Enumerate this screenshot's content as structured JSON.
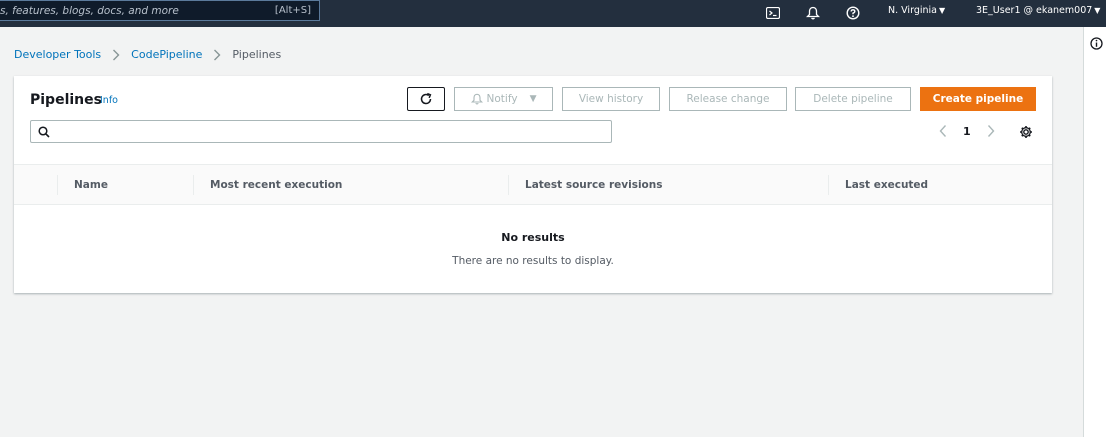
{
  "topbar": {
    "search_placeholder": "s, features, blogs, docs, and more",
    "search_shortcut": "[Alt+S]",
    "region": "N. Virginia",
    "account": "3E_User1 @ ekanem007",
    "icons": [
      "cloudshell-icon",
      "bell-icon",
      "help-icon"
    ]
  },
  "breadcrumb": {
    "items": [
      "Developer Tools",
      "CodePipeline",
      "Pipelines"
    ]
  },
  "panel": {
    "title": "Pipelines",
    "info": "Info",
    "buttons": {
      "notify": "Notify",
      "view_history": "View history",
      "release_change": "Release change",
      "delete_pipeline": "Delete pipeline",
      "create_pipeline": "Create pipeline"
    },
    "filter_placeholder": "",
    "page_number": "1"
  },
  "table": {
    "columns": [
      "Name",
      "Most recent execution",
      "Latest source revisions",
      "Last executed"
    ],
    "empty_title": "No results",
    "empty_description": "There are no results to display."
  },
  "colors": {
    "nav_bg": "#232f3e",
    "primary_button": "#ec7211",
    "link": "#0073bb"
  }
}
